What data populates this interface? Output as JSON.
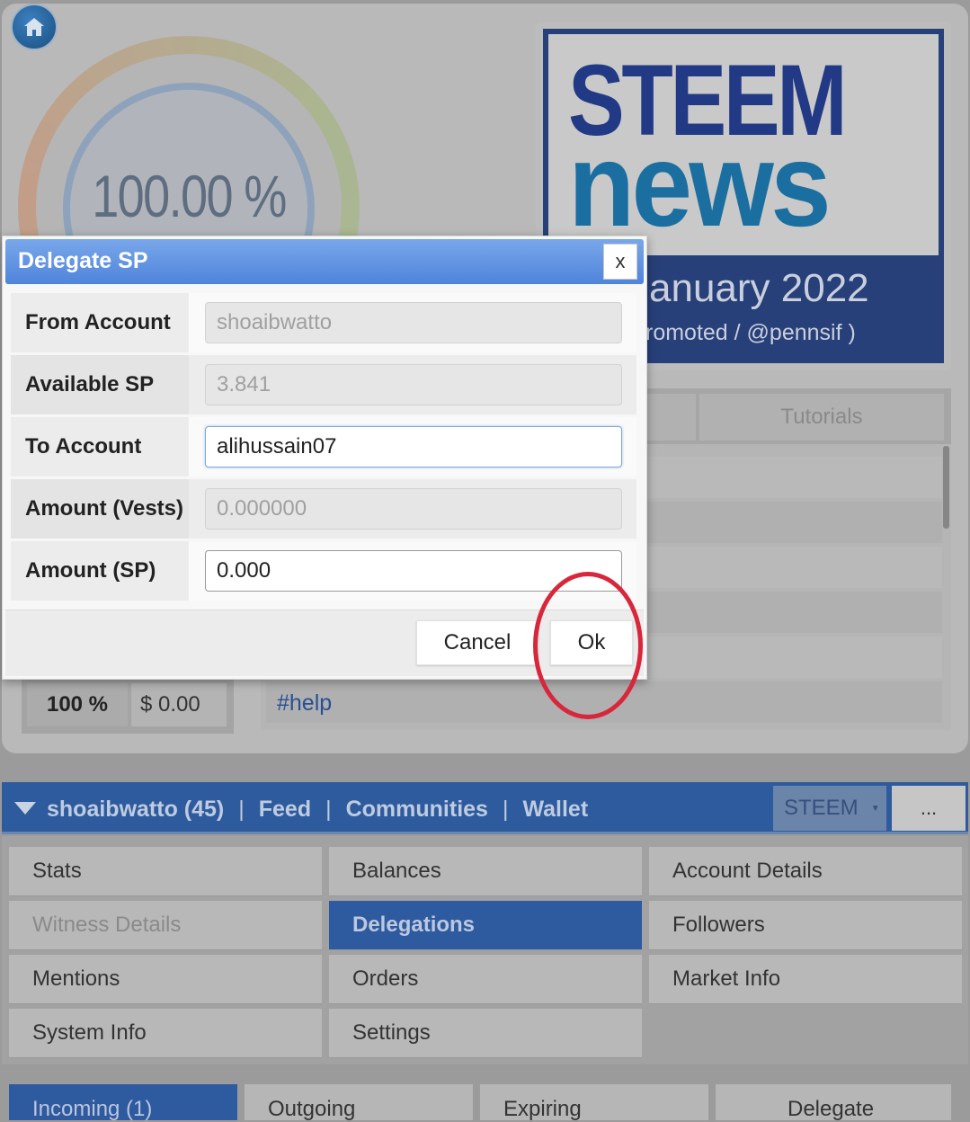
{
  "gauge": {
    "value_label": "100.00 %"
  },
  "banner": {
    "line1": "STEEM",
    "line2": "news",
    "date": "January 2022",
    "promo": "romoted / @pennsif )"
  },
  "side_tabs": {
    "tutorials": "Tutorials"
  },
  "tag": "#help",
  "stats_row": {
    "percent": "100 %",
    "usd": "$ 0.00"
  },
  "dialog": {
    "title": "Delegate SP",
    "close": "x",
    "rows": [
      {
        "label": "From Account",
        "value": "shoaibwatto"
      },
      {
        "label": "Available SP",
        "value": "3.841"
      },
      {
        "label": "To Account",
        "value": "alihussain07"
      },
      {
        "label": "Amount (Vests)",
        "value": "0.000000"
      },
      {
        "label": "Amount (SP)",
        "value": "0.000"
      }
    ],
    "cancel": "Cancel",
    "ok": "Ok"
  },
  "user_bar": {
    "user": "shoaibwatto (45)",
    "sep": "|",
    "links": [
      "Feed",
      "Communities",
      "Wallet"
    ],
    "currency": "STEEM",
    "more": "..."
  },
  "menu": [
    [
      "Stats",
      "Balances",
      "Account Details"
    ],
    [
      "Witness Details",
      "Delegations",
      "Followers"
    ],
    [
      "Mentions",
      "Orders",
      "Market Info"
    ],
    [
      "System Info",
      "Settings"
    ]
  ],
  "bottom_tabs": [
    "Incoming (1)",
    "Outgoing",
    "Expiring",
    "Delegate"
  ],
  "colors": {
    "accent": "#4f84db",
    "annotation": "#d8263b",
    "active_tab": "#2e5aa0"
  }
}
